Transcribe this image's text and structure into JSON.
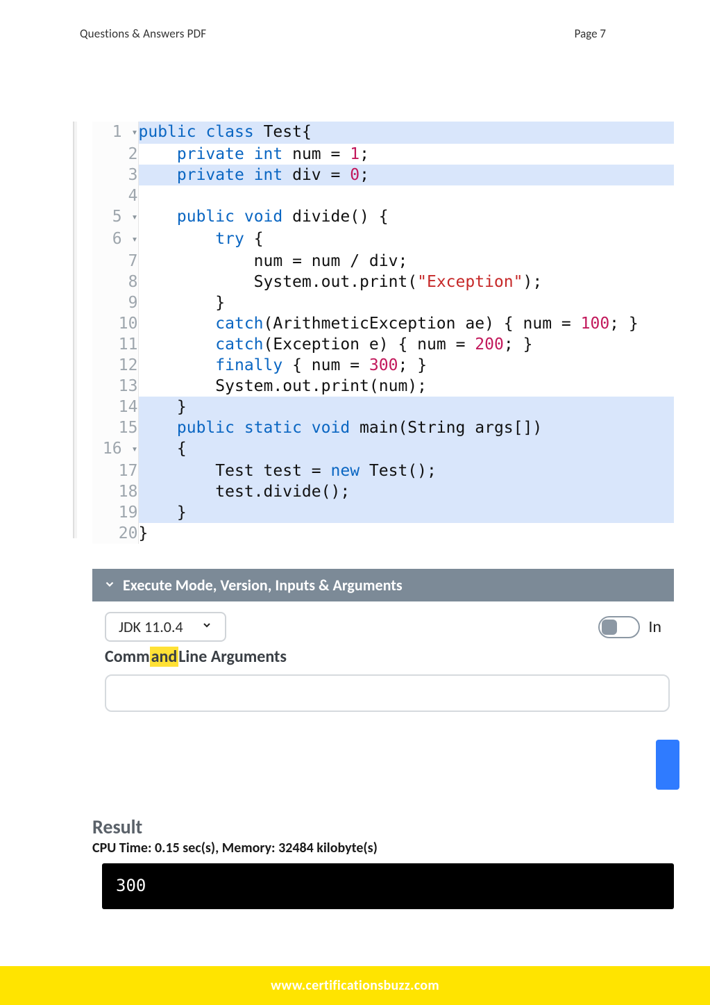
{
  "header": {
    "left": "Questions & Answers PDF",
    "right": "Page 7"
  },
  "code": {
    "lines": [
      {
        "n": "1",
        "fold": true,
        "hl": true,
        "tokens": [
          [
            "kw",
            "public"
          ],
          [
            "sp",
            " "
          ],
          [
            "kw",
            "class"
          ],
          [
            "sp",
            " "
          ],
          [
            "nm",
            "Test"
          ],
          [
            "op",
            "{"
          ]
        ]
      },
      {
        "n": "2",
        "fold": false,
        "hl": false,
        "tokens": [
          [
            "sp",
            "    "
          ],
          [
            "kw",
            "private"
          ],
          [
            "sp",
            " "
          ],
          [
            "type",
            "int"
          ],
          [
            "sp",
            " "
          ],
          [
            "nm",
            "num"
          ],
          [
            "sp",
            " "
          ],
          [
            "op",
            "="
          ],
          [
            "sp",
            " "
          ],
          [
            "num",
            "1"
          ],
          [
            "op",
            ";"
          ]
        ]
      },
      {
        "n": "3",
        "fold": false,
        "hl": true,
        "tokens": [
          [
            "sp",
            "    "
          ],
          [
            "kw",
            "private"
          ],
          [
            "sp",
            " "
          ],
          [
            "type",
            "int"
          ],
          [
            "sp",
            " "
          ],
          [
            "nm",
            "div"
          ],
          [
            "sp",
            " "
          ],
          [
            "op",
            "="
          ],
          [
            "sp",
            " "
          ],
          [
            "num",
            "0"
          ],
          [
            "op",
            ";"
          ]
        ]
      },
      {
        "n": "4",
        "fold": false,
        "hl": false,
        "tokens": []
      },
      {
        "n": "5",
        "fold": true,
        "hl": false,
        "tokens": [
          [
            "sp",
            "    "
          ],
          [
            "kw",
            "public"
          ],
          [
            "sp",
            " "
          ],
          [
            "type",
            "void"
          ],
          [
            "sp",
            " "
          ],
          [
            "nm",
            "divide"
          ],
          [
            "op",
            "()"
          ],
          [
            "sp",
            " "
          ],
          [
            "op",
            "{"
          ]
        ]
      },
      {
        "n": "6",
        "fold": true,
        "hl": false,
        "tokens": [
          [
            "sp",
            "        "
          ],
          [
            "kw",
            "try"
          ],
          [
            "sp",
            " "
          ],
          [
            "op",
            "{"
          ]
        ]
      },
      {
        "n": "7",
        "fold": false,
        "hl": false,
        "tokens": [
          [
            "sp",
            "            "
          ],
          [
            "nm",
            "num"
          ],
          [
            "sp",
            " "
          ],
          [
            "op",
            "="
          ],
          [
            "sp",
            " "
          ],
          [
            "nm",
            "num"
          ],
          [
            "sp",
            " "
          ],
          [
            "op",
            "/"
          ],
          [
            "sp",
            " "
          ],
          [
            "nm",
            "div"
          ],
          [
            "op",
            ";"
          ]
        ]
      },
      {
        "n": "8",
        "fold": false,
        "hl": false,
        "tokens": [
          [
            "sp",
            "            "
          ],
          [
            "nm",
            "System"
          ],
          [
            "op",
            "."
          ],
          [
            "nm",
            "out"
          ],
          [
            "op",
            "."
          ],
          [
            "nm",
            "print"
          ],
          [
            "op",
            "("
          ],
          [
            "str",
            "\"Exception\""
          ],
          [
            "op",
            ")"
          ],
          [
            "op",
            ";"
          ]
        ]
      },
      {
        "n": "9",
        "fold": false,
        "hl": false,
        "tokens": [
          [
            "sp",
            "        "
          ],
          [
            "op",
            "}"
          ]
        ]
      },
      {
        "n": "10",
        "fold": false,
        "hl": false,
        "tokens": [
          [
            "sp",
            "        "
          ],
          [
            "kw",
            "catch"
          ],
          [
            "op",
            "("
          ],
          [
            "nm",
            "ArithmeticException"
          ],
          [
            "sp",
            " "
          ],
          [
            "nm",
            "ae"
          ],
          [
            "op",
            ")"
          ],
          [
            "sp",
            " "
          ],
          [
            "op",
            "{"
          ],
          [
            "sp",
            " "
          ],
          [
            "nm",
            "num"
          ],
          [
            "sp",
            " "
          ],
          [
            "op",
            "="
          ],
          [
            "sp",
            " "
          ],
          [
            "num",
            "100"
          ],
          [
            "op",
            ";"
          ],
          [
            "sp",
            " "
          ],
          [
            "op",
            "}"
          ]
        ]
      },
      {
        "n": "11",
        "fold": false,
        "hl": false,
        "tokens": [
          [
            "sp",
            "        "
          ],
          [
            "kw",
            "catch"
          ],
          [
            "op",
            "("
          ],
          [
            "nm",
            "Exception"
          ],
          [
            "sp",
            " "
          ],
          [
            "nm",
            "e"
          ],
          [
            "op",
            ")"
          ],
          [
            "sp",
            " "
          ],
          [
            "op",
            "{"
          ],
          [
            "sp",
            " "
          ],
          [
            "nm",
            "num"
          ],
          [
            "sp",
            " "
          ],
          [
            "op",
            "="
          ],
          [
            "sp",
            " "
          ],
          [
            "num",
            "200"
          ],
          [
            "op",
            ";"
          ],
          [
            "sp",
            " "
          ],
          [
            "op",
            "}"
          ]
        ]
      },
      {
        "n": "12",
        "fold": false,
        "hl": false,
        "tokens": [
          [
            "sp",
            "        "
          ],
          [
            "kw",
            "finally"
          ],
          [
            "sp",
            " "
          ],
          [
            "op",
            "{"
          ],
          [
            "sp",
            " "
          ],
          [
            "nm",
            "num"
          ],
          [
            "sp",
            " "
          ],
          [
            "op",
            "="
          ],
          [
            "sp",
            " "
          ],
          [
            "num",
            "300"
          ],
          [
            "op",
            ";"
          ],
          [
            "sp",
            " "
          ],
          [
            "op",
            "}"
          ]
        ]
      },
      {
        "n": "13",
        "fold": false,
        "hl": false,
        "tokens": [
          [
            "sp",
            "        "
          ],
          [
            "nm",
            "System"
          ],
          [
            "op",
            "."
          ],
          [
            "nm",
            "out"
          ],
          [
            "op",
            "."
          ],
          [
            "nm",
            "print"
          ],
          [
            "op",
            "("
          ],
          [
            "nm",
            "num"
          ],
          [
            "op",
            ")"
          ],
          [
            "op",
            ";"
          ]
        ]
      },
      {
        "n": "14",
        "fold": false,
        "hl": true,
        "tokens": [
          [
            "sp",
            "    "
          ],
          [
            "op",
            "}"
          ]
        ]
      },
      {
        "n": "15",
        "fold": false,
        "hl": true,
        "tokens": [
          [
            "sp",
            "    "
          ],
          [
            "kw",
            "public"
          ],
          [
            "sp",
            " "
          ],
          [
            "kw",
            "static"
          ],
          [
            "sp",
            " "
          ],
          [
            "type",
            "void"
          ],
          [
            "sp",
            " "
          ],
          [
            "nm",
            "main"
          ],
          [
            "op",
            "("
          ],
          [
            "nm",
            "String"
          ],
          [
            "sp",
            " "
          ],
          [
            "nm",
            "args"
          ],
          [
            "op",
            "[])"
          ]
        ]
      },
      {
        "n": "16",
        "fold": true,
        "hl": true,
        "tokens": [
          [
            "sp",
            "    "
          ],
          [
            "op",
            "{"
          ]
        ]
      },
      {
        "n": "17",
        "fold": false,
        "hl": true,
        "tokens": [
          [
            "sp",
            "        "
          ],
          [
            "nm",
            "Test"
          ],
          [
            "sp",
            " "
          ],
          [
            "nm",
            "test"
          ],
          [
            "sp",
            " "
          ],
          [
            "op",
            "="
          ],
          [
            "sp",
            " "
          ],
          [
            "kw",
            "new"
          ],
          [
            "sp",
            " "
          ],
          [
            "nm",
            "Test"
          ],
          [
            "op",
            "()"
          ],
          [
            "op",
            ";"
          ]
        ]
      },
      {
        "n": "18",
        "fold": false,
        "hl": true,
        "tokens": [
          [
            "sp",
            "        "
          ],
          [
            "nm",
            "test"
          ],
          [
            "op",
            "."
          ],
          [
            "nm",
            "divide"
          ],
          [
            "op",
            "()"
          ],
          [
            "op",
            ";"
          ]
        ]
      },
      {
        "n": "19",
        "fold": false,
        "hl": true,
        "tokens": [
          [
            "sp",
            "    "
          ],
          [
            "op",
            "}"
          ]
        ]
      },
      {
        "n": "20",
        "fold": false,
        "hl": false,
        "tokens": [
          [
            "op",
            "}"
          ]
        ]
      }
    ]
  },
  "exec": {
    "header": "Execute Mode, Version, Inputs & Arguments",
    "jdk": "JDK 11.0.4",
    "toggle_label": "In",
    "cmd_label_pre": "Comm",
    "cmd_label_hl": "and",
    "cmd_label_post": "Line Arguments",
    "cmd_value": ""
  },
  "result": {
    "title": "Result",
    "cpu": "CPU Time: 0.15 sec(s), Memory: 32484 kilobyte(s)",
    "output": "300"
  },
  "footer": {
    "url": "www.certificationsbuzz.com"
  }
}
